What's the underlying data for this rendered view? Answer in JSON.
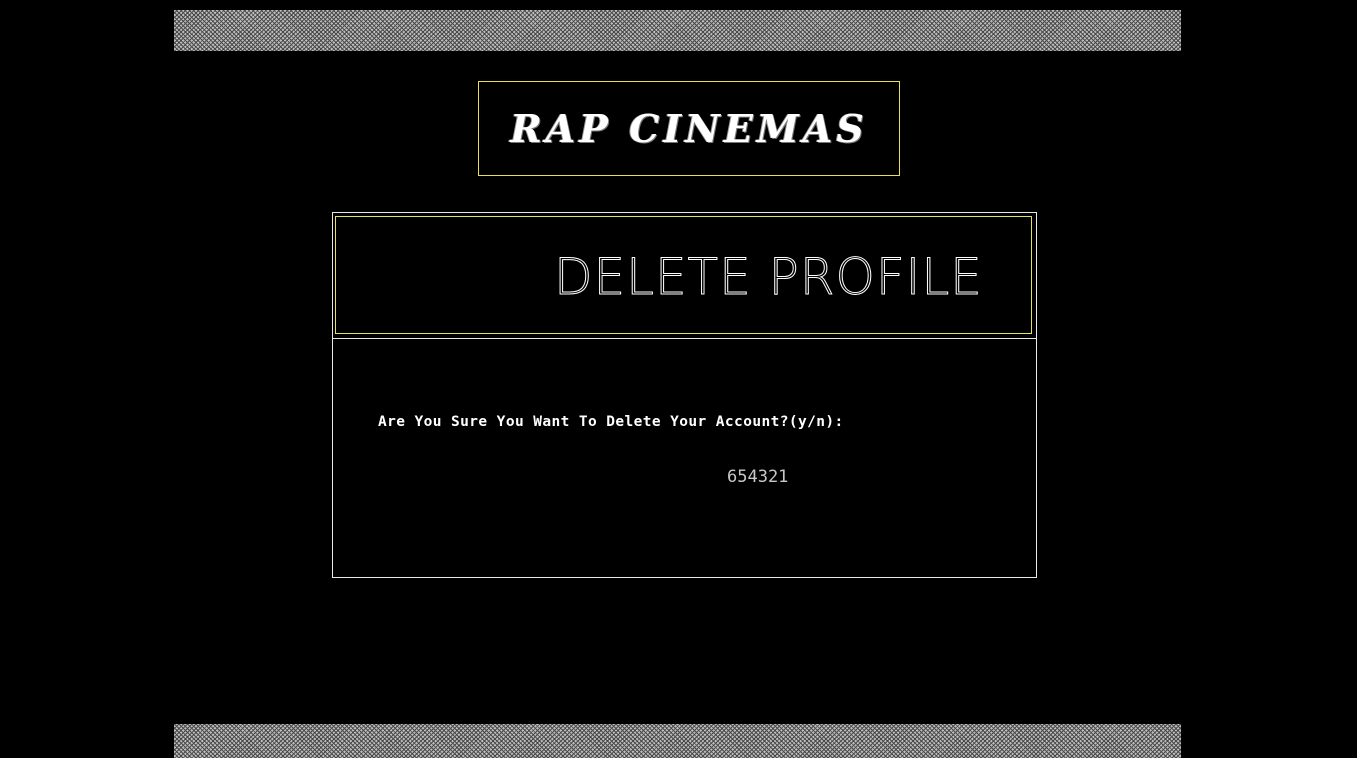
{
  "app": {
    "logo_text": "RAP CINEMAS"
  },
  "dialog": {
    "title": "DELETE PROFILE",
    "prompt": "Are You Sure You Want To Delete Your Account?(y/n):",
    "input_value": "654321"
  },
  "colors": {
    "background": "#000000",
    "logo_border": "#e8e05a",
    "dialog_border": "#e8e8e8",
    "text": "#ffffff",
    "input_text": "#c8c8c8",
    "stripe": "#bdbdbd"
  }
}
